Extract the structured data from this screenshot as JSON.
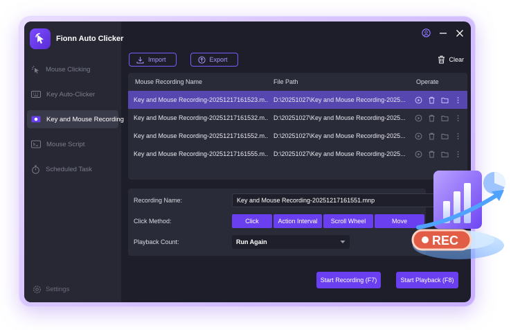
{
  "app": {
    "name": "Fionn Auto Clicker"
  },
  "sidebar": {
    "items": [
      {
        "label": "Mouse Clicking",
        "icon": "cursor-click-icon",
        "active": false
      },
      {
        "label": "Key Auto-Clicker",
        "icon": "keyboard-icon",
        "active": false
      },
      {
        "label": "Key and Mouse Recording",
        "icon": "record-icon",
        "active": true
      },
      {
        "label": "Mouse Script",
        "icon": "terminal-icon",
        "active": false
      },
      {
        "label": "Scheduled Task",
        "icon": "stopwatch-icon",
        "active": false
      }
    ],
    "settings_label": "Settings"
  },
  "toolbar": {
    "import_label": "Import",
    "export_label": "Export",
    "clear_label": "Clear"
  },
  "table": {
    "headers": [
      "Mouse Recording Name",
      "File Path",
      "Operate"
    ],
    "rows": [
      {
        "name": "Key and Mouse Recording-20251217161523.m...",
        "path": "D:\\20251027\\Key and Mouse Recording-2025...",
        "selected": true
      },
      {
        "name": "Key and Mouse Recording-20251217161532.m...",
        "path": "D:\\20251027\\Key and Mouse Recording-2025...",
        "selected": false
      },
      {
        "name": "Key and Mouse Recording-20251217161552.m...",
        "path": "D:\\20251027\\Key and Mouse Recording-2025...",
        "selected": false
      },
      {
        "name": "Key and Mouse Recording-20251217161555.m...",
        "path": "D:\\20251027\\Key and Mouse Recording-2025...",
        "selected": false
      }
    ]
  },
  "form": {
    "recording_name_label": "Recording Name:",
    "recording_name_value": "Key and Mouse Recording-20251217161551.mnp",
    "click_method_label": "Click Method:",
    "click_methods": [
      "Click",
      "Action Interval",
      "Scroll Wheel",
      "Move"
    ],
    "playback_count_label": "Playback Count:",
    "playback_count_value": "Run Again"
  },
  "actions": {
    "start_recording": "Start Recording (F7)",
    "start_playback": "Start Playback (F8)"
  },
  "illustration": {
    "badge": "REC"
  },
  "colors": {
    "accent": "#6a3ff0",
    "selected_row": "#5546b0",
    "background": "#1d1e29",
    "sidebar": "#272834"
  }
}
